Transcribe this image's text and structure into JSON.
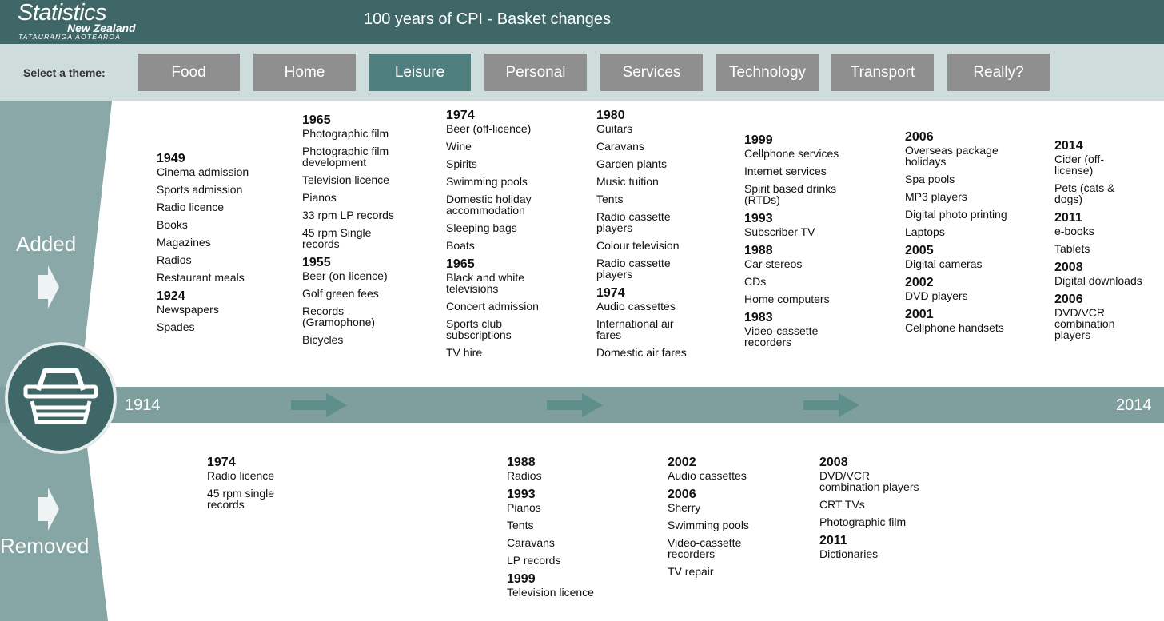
{
  "header": {
    "logo_line1": "Statistics",
    "logo_line2": "New Zealand",
    "logo_line3": "TATAURANGA AOTEAROA",
    "title": "100 years of CPI - Basket changes"
  },
  "themes": {
    "label": "Select a theme:",
    "tabs": [
      "Food",
      "Home",
      "Leisure",
      "Personal",
      "Services",
      "Technology",
      "Transport",
      "Really?"
    ],
    "active": "Leisure"
  },
  "timeline": {
    "start": "1914",
    "end": "2014",
    "added_label": "Added",
    "removed_label": "Removed"
  },
  "colors": {
    "header": "#3f6767",
    "active_tab": "#4f7f7f",
    "tab": "#8f8f8f",
    "band": "#7f9f9f"
  },
  "added": [
    {
      "groups": [
        {
          "year": "1949",
          "items": [
            "Cinema admission",
            "Sports admission",
            "Radio licence",
            "Books",
            "Magazines",
            "Radios",
            "Restaurant meals"
          ]
        },
        {
          "year": "1924",
          "items": [
            "Newspapers",
            "Spades"
          ]
        }
      ]
    },
    {
      "groups": [
        {
          "year": "1965",
          "items": [
            "Photographic film",
            "Photographic film development",
            "Television licence",
            "Pianos",
            "33 rpm LP records",
            "45 rpm Single records"
          ]
        },
        {
          "year": "1955",
          "items": [
            "Beer (on-licence)",
            "Golf green fees",
            "Records (Gramophone)",
            "Bicycles"
          ]
        }
      ]
    },
    {
      "groups": [
        {
          "year": "1974",
          "items": [
            "Beer (off-licence)",
            "Wine",
            "Spirits",
            "Swimming pools",
            "Domestic holiday accommodation",
            "Sleeping bags",
            "Boats"
          ]
        },
        {
          "year": "1965",
          "items": [
            "Black and white televisions",
            "Concert admission",
            "Sports club subscriptions",
            "TV hire"
          ]
        }
      ]
    },
    {
      "groups": [
        {
          "year": "1980",
          "items": [
            "Guitars",
            "Caravans",
            "Garden plants",
            "Music tuition",
            "Tents",
            "Radio cassette players",
            "Colour television",
            "Radio cassette players"
          ]
        },
        {
          "year": "1974",
          "items": [
            "Audio cassettes",
            "International air fares",
            "Domestic air fares"
          ]
        }
      ]
    },
    {
      "groups": [
        {
          "year": "1999",
          "items": [
            "Cellphone services",
            "Internet services",
            "Spirit based drinks (RTDs)"
          ]
        },
        {
          "year": "1993",
          "items": [
            "Subscriber TV"
          ]
        },
        {
          "year": "1988",
          "items": [
            "Car stereos",
            "CDs",
            "Home computers"
          ]
        },
        {
          "year": "1983",
          "items": [
            "Video-cassette recorders"
          ]
        }
      ]
    },
    {
      "groups": [
        {
          "year": "2006",
          "items": [
            "Overseas package holidays",
            "Spa pools",
            "MP3 players",
            "Digital photo printing",
            "Laptops"
          ]
        },
        {
          "year": "2005",
          "items": [
            "Digital cameras"
          ]
        },
        {
          "year": "2002",
          "items": [
            "DVD players"
          ]
        },
        {
          "year": "2001",
          "items": [
            "Cellphone handsets"
          ]
        }
      ]
    },
    {
      "groups": [
        {
          "year": "2014",
          "items": [
            "Cider (off-license)",
            "Pets (cats & dogs)"
          ]
        },
        {
          "year": "2011",
          "items": [
            "e-books",
            "Tablets"
          ]
        },
        {
          "year": "2008",
          "items": [
            "Digital downloads"
          ]
        },
        {
          "year": "2006",
          "items": [
            "DVD/VCR combination players"
          ]
        }
      ]
    }
  ],
  "removed": [
    {
      "groups": [
        {
          "year": "1974",
          "items": [
            "Radio licence",
            "45 rpm single records"
          ]
        }
      ]
    },
    {
      "groups": [
        {
          "year": "1988",
          "items": [
            "Radios"
          ]
        },
        {
          "year": "1993",
          "items": [
            "Pianos",
            "Tents",
            "Caravans",
            "LP records"
          ]
        },
        {
          "year": "1999",
          "items": [
            "Television licence"
          ]
        }
      ]
    },
    {
      "groups": [
        {
          "year": "2002",
          "items": [
            "Audio cassettes"
          ]
        },
        {
          "year": "2006",
          "items": [
            "Sherry",
            "Swimming pools",
            "Video-cassette recorders",
            "TV repair"
          ]
        }
      ]
    },
    {
      "groups": [
        {
          "year": "2008",
          "items": [
            "DVD/VCR combination players",
            "CRT TVs",
            "Photographic film"
          ]
        },
        {
          "year": "2011",
          "items": [
            "Dictionaries"
          ]
        }
      ]
    }
  ]
}
